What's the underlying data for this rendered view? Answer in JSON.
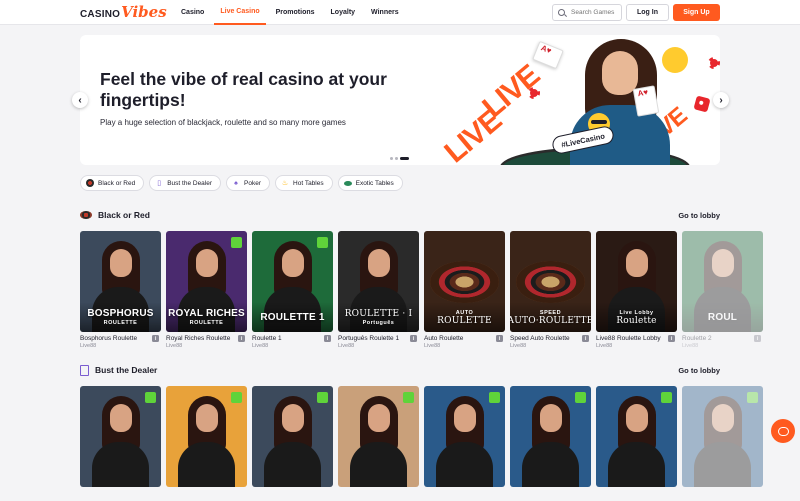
{
  "header": {
    "logo_casino": "CASINO",
    "logo_vibes": "Vibes",
    "nav": [
      "Casino",
      "Live Casino",
      "Promotions",
      "Loyalty",
      "Winners"
    ],
    "active_nav": "Live Casino",
    "search_placeholder": "Search Games",
    "login_label": "Log In",
    "signup_label": "Sign Up"
  },
  "hero": {
    "title": "Feel the vibe of real casino at your fingertips!",
    "subtitle": "Play a huge selection of blackjack, roulette and so many more games",
    "badge": "#LiveCasino",
    "art_word": "LIVE",
    "slide_count": 3,
    "active_slide": 3
  },
  "pills": [
    {
      "label": "Black or Red",
      "icon": "roulette-icon"
    },
    {
      "label": "Bust the Dealer",
      "icon": "card-icon"
    },
    {
      "label": "Poker",
      "icon": "poker-icon"
    },
    {
      "label": "Hot Tables",
      "icon": "flame-icon"
    },
    {
      "label": "Exotic Tables",
      "icon": "table-icon"
    }
  ],
  "sections": [
    {
      "title": "Black or Red",
      "lobby_label": "Go to lobby",
      "games": [
        {
          "name": "Bosphorus Roulette",
          "provider": "Live88",
          "thumb_title": "BOSPHORUS",
          "thumb_sub": "ROULETTE",
          "bg": "#3c4a5c",
          "kind": "dealer"
        },
        {
          "name": "Royal Riches Roulette",
          "provider": "Live88",
          "thumb_title": "ROYAL RICHES",
          "thumb_sub": "ROULETTE",
          "bg": "#4a2a6e",
          "kind": "dealer"
        },
        {
          "name": "Roulette 1",
          "provider": "Live88",
          "thumb_title": "ROULETTE 1",
          "thumb_sub": "",
          "bg": "#1e6b3a",
          "kind": "dealer"
        },
        {
          "name": "Português Roulette 1",
          "provider": "Live88",
          "thumb_title": "ROULETTE · I",
          "thumb_sub": "Português",
          "bg": "#2a2a2a",
          "kind": "dealer"
        },
        {
          "name": "Auto Roulette",
          "provider": "Live88",
          "thumb_title": "ROULETTE",
          "thumb_sub": "AUTO",
          "bg": "#3a2418",
          "kind": "wheel"
        },
        {
          "name": "Speed Auto Roulette",
          "provider": "Live88",
          "thumb_title": "AUTO·ROULETTE",
          "thumb_sub": "SPEED",
          "bg": "#3a2418",
          "kind": "wheel"
        },
        {
          "name": "Live88 Roulette Lobby",
          "provider": "Live88",
          "thumb_title": "Roulette",
          "thumb_sub": "Live Lobby",
          "bg": "#2a1a14",
          "kind": "dealer"
        },
        {
          "name": "Roulette 2",
          "provider": "Live88",
          "thumb_title": "ROUL",
          "thumb_sub": "",
          "bg": "#1e6b3a",
          "kind": "dealer"
        }
      ]
    },
    {
      "title": "Bust the Dealer",
      "lobby_label": "Go to lobby",
      "games": [
        {
          "bg": "#3c4a5c"
        },
        {
          "bg": "#e8a23a"
        },
        {
          "bg": "#3c4a5c"
        },
        {
          "bg": "#c9a07a"
        },
        {
          "bg": "#2a5a8a"
        },
        {
          "bg": "#2a5a8a"
        },
        {
          "bg": "#2a5a8a"
        },
        {
          "bg": "#2a5a8a"
        }
      ]
    }
  ],
  "colors": {
    "accent": "#ff5a1f",
    "text": "#1e1e2a",
    "page_bg": "#f4f4f6"
  }
}
